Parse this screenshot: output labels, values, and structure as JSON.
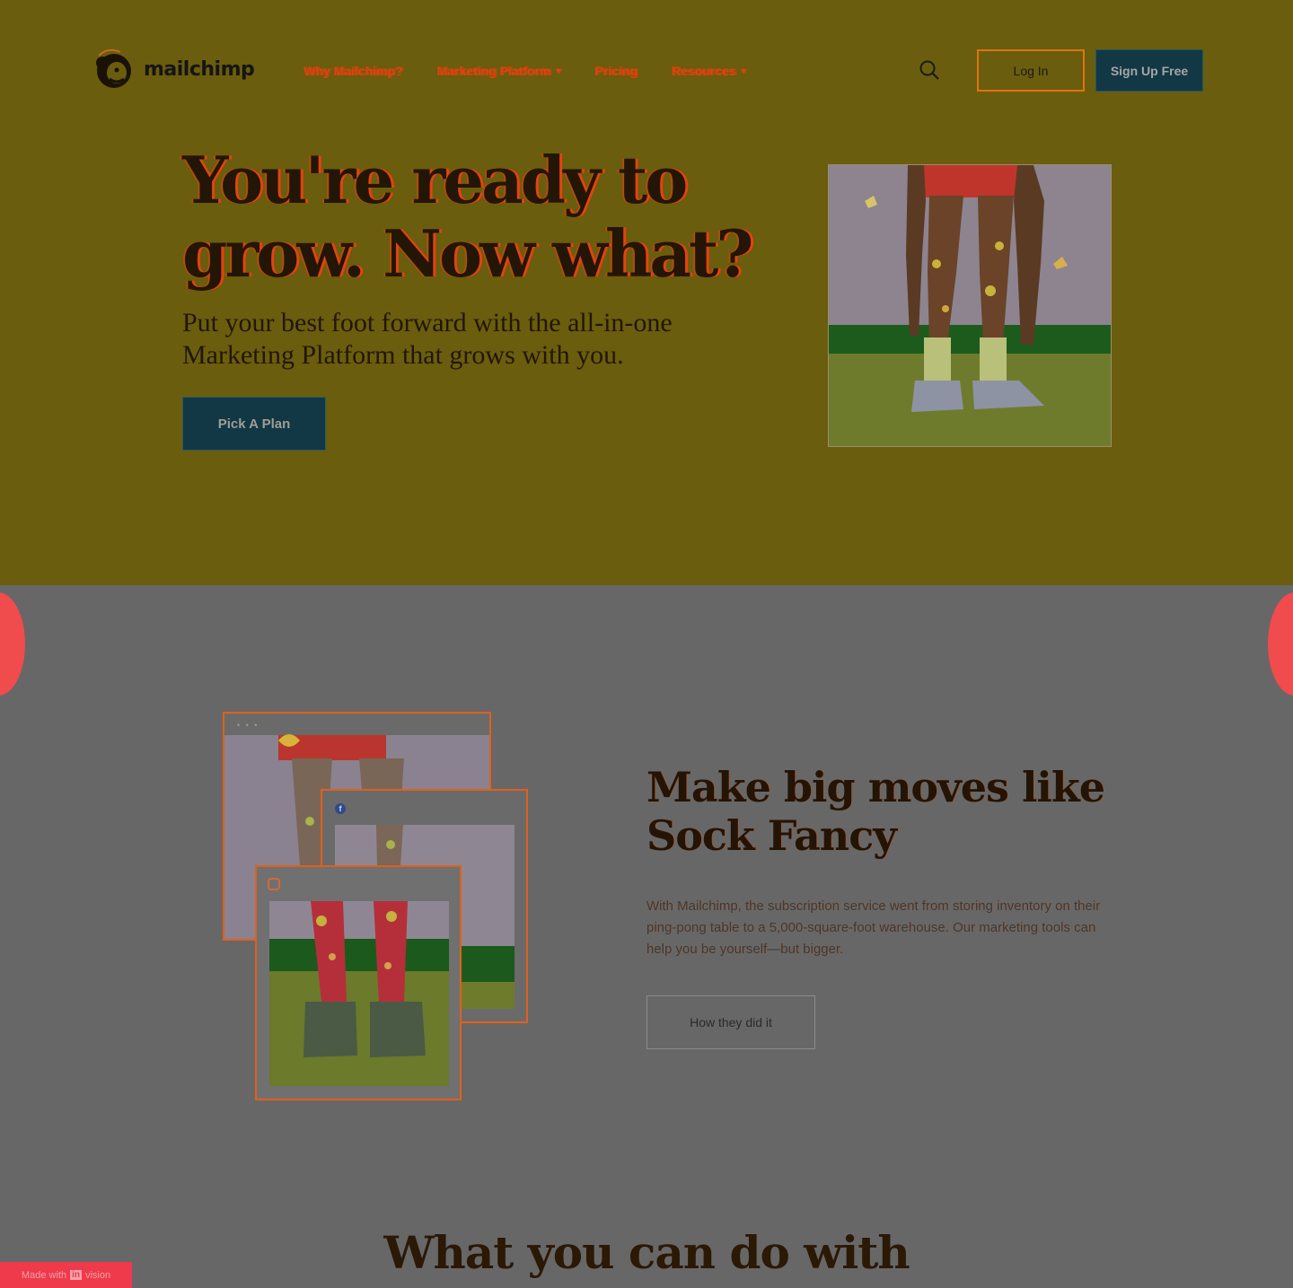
{
  "brand": {
    "name": "mailchimp"
  },
  "nav": {
    "items": [
      {
        "label": "Why Mailchimp?",
        "has_dropdown": false
      },
      {
        "label": "Marketing Platform",
        "has_dropdown": true
      },
      {
        "label": "Pricing",
        "has_dropdown": false
      },
      {
        "label": "Resources",
        "has_dropdown": true
      }
    ],
    "search_icon": "search-icon",
    "login_label": "Log In",
    "signup_label": "Sign Up Free"
  },
  "hero": {
    "title_line1": "You're ready to",
    "title_line2": "grow. Now what?",
    "subtitle_line1": "Put your best foot forward with the all-in-one",
    "subtitle_line2": "Marketing Platform that grows with you.",
    "cta_label": "Pick A Plan"
  },
  "case_study": {
    "title_line1": "Make big moves like",
    "title_line2": "Sock Fancy",
    "body": "With Mailchimp, the subscription service went from storing inventory on their ping-pong table to a 5,000-square-foot warehouse. Our marketing tools can help you be yourself—but bigger.",
    "cta_label": "How they did it",
    "window_dots": "• • •",
    "facebook_glyph": "f"
  },
  "features": {
    "title": "What you can do with"
  },
  "badge": {
    "prefix": "Made with",
    "brand": "in",
    "suffix": "vision"
  },
  "colors": {
    "hero_bg": "#6a5d0d",
    "section_bg": "#676767",
    "accent_orange": "#e4400f",
    "dark_teal": "#113844",
    "coral": "#f04b4d"
  }
}
